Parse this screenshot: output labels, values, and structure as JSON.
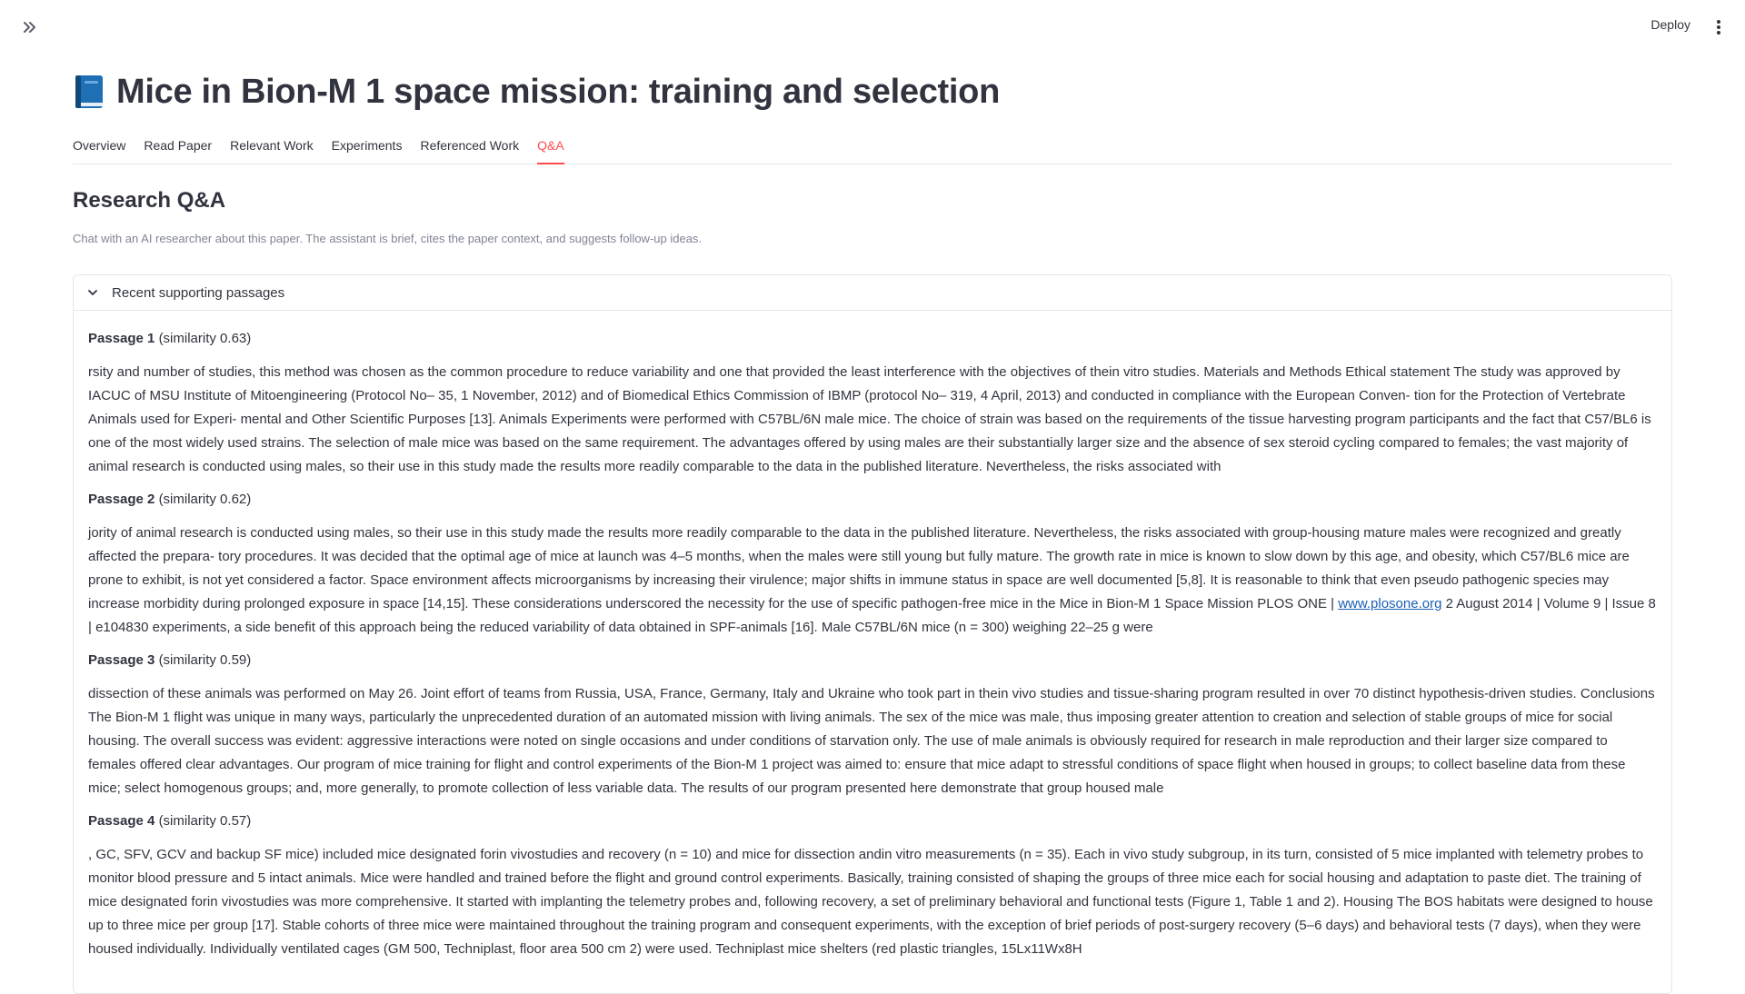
{
  "header": {
    "deploy_label": "Deploy"
  },
  "page": {
    "title": "Mice in Bion-M 1 space mission: training and selection",
    "icon": "book-icon"
  },
  "tabs": [
    {
      "label": "Overview"
    },
    {
      "label": "Read Paper"
    },
    {
      "label": "Relevant Work"
    },
    {
      "label": "Experiments"
    },
    {
      "label": "Referenced Work"
    },
    {
      "label": "Q&A",
      "active": true
    }
  ],
  "qa": {
    "heading": "Research Q&A",
    "caption": "Chat with an AI researcher about this paper. The assistant is brief, cites the paper context, and suggests follow-up ideas.",
    "expander_label": "Recent supporting passages",
    "passages": [
      {
        "label": "Passage 1",
        "similarity": "(similarity 0.63)",
        "text": "rsity and number of studies, this method was chosen as the common procedure to reduce variability and one that provided the least interference with the objectives of thein vitro studies. Materials and Methods Ethical statement The study was approved by IACUC of MSU Institute of Mitoengineering (Protocol No– 35, 1 November, 2012) and of Biomedical Ethics Commission of IBMP (protocol No– 319, 4 April, 2013) and conducted in compliance with the European Conven- tion for the Protection of Vertebrate Animals used for Experi- mental and Other Scientific Purposes [13]. Animals Experiments were performed with C57BL/6N male mice. The choice of strain was based on the requirements of the tissue harvesting program participants and the fact that C57/BL6 is one of the most widely used strains. The selection of male mice was based on the same requirement. The advantages offered by using males are their substantially larger size and the absence of sex steroid cycling compared to females; the vast majority of animal research is conducted using males, so their use in this study made the results more readily comparable to the data in the published literature. Nevertheless, the risks associated with"
      },
      {
        "label": "Passage 2",
        "similarity": "(similarity 0.62)",
        "text_before": "jority of animal research is conducted using males, so their use in this study made the results more readily comparable to the data in the published literature. Nevertheless, the risks associated with group-housing mature males were recognized and greatly affected the prepara- tory procedures. It was decided that the optimal age of mice at launch was 4–5 months, when the males were still young but fully mature. The growth rate in mice is known to slow down by this age, and obesity, which C57/BL6 mice are prone to exhibit, is not yet considered a factor. Space environment affects microorganisms by increasing their virulence; major shifts in immune status in space are well documented [5,8]. It is reasonable to think that even pseudo pathogenic species may increase morbidity during prolonged exposure in space [14,15]. These considerations underscored the necessity for the use of specific pathogen-free mice in the Mice in Bion-M 1 Space Mission PLOS ONE | ",
        "link": "www.plosone.org",
        "text_after": " 2 August 2014 | Volume 9 | Issue 8 | e104830 experiments, a side benefit of this approach being the reduced variability of data obtained in SPF-animals [16]. Male C57BL/6N mice (n = 300) weighing 22–25 g were"
      },
      {
        "label": "Passage 3",
        "similarity": "(similarity 0.59)",
        "text": "dissection of these animals was performed on May 26. Joint effort of teams from Russia, USA, France, Germany, Italy and Ukraine who took part in thein vivo studies and tissue-sharing program resulted in over 70 distinct hypothesis-driven studies. Conclusions The Bion-M 1 flight was unique in many ways, particularly the unprecedented duration of an automated mission with living animals. The sex of the mice was male, thus imposing greater attention to creation and selection of stable groups of mice for social housing. The overall success was evident: aggressive interactions were noted on single occasions and under conditions of starvation only. The use of male animals is obviously required for research in male reproduction and their larger size compared to females offered clear advantages. Our program of mice training for flight and control experiments of the Bion-M 1 project was aimed to: ensure that mice adapt to stressful conditions of space flight when housed in groups; to collect baseline data from these mice; select homogenous groups; and, more generally, to promote collection of less variable data. The results of our program presented here demonstrate that group housed male"
      },
      {
        "label": "Passage 4",
        "similarity": "(similarity 0.57)",
        "text": ", GC, SFV, GCV and backup SF mice) included mice designated forin vivostudies and recovery (n = 10) and mice for dissection andin vitro measurements (n = 35). Each in vivo study subgroup, in its turn, consisted of 5 mice implanted with telemetry probes to monitor blood pressure and 5 intact animals. Mice were handled and trained before the flight and ground control experiments. Basically, training consisted of shaping the groups of three mice each for social housing and adaptation to paste diet. The training of mice designated forin vivostudies was more comprehensive. It started with implanting the telemetry probes and, following recovery, a set of preliminary behavioral and functional tests (Figure 1, Table 1 and 2). Housing The BOS habitats were designed to house up to three mice per group [17]. Stable cohorts of three mice were maintained throughout the training program and consequent experiments, with the exception of brief periods of post-surgery recovery (5–6 days) and behavioral tests (7 days), when they were housed individually. Individually ventilated cages (GM 500, Techniplast, floor area 500 cm 2) were used. Techniplast mice shelters (red plastic triangles, 15Lx11Wx8H"
      }
    ]
  }
}
